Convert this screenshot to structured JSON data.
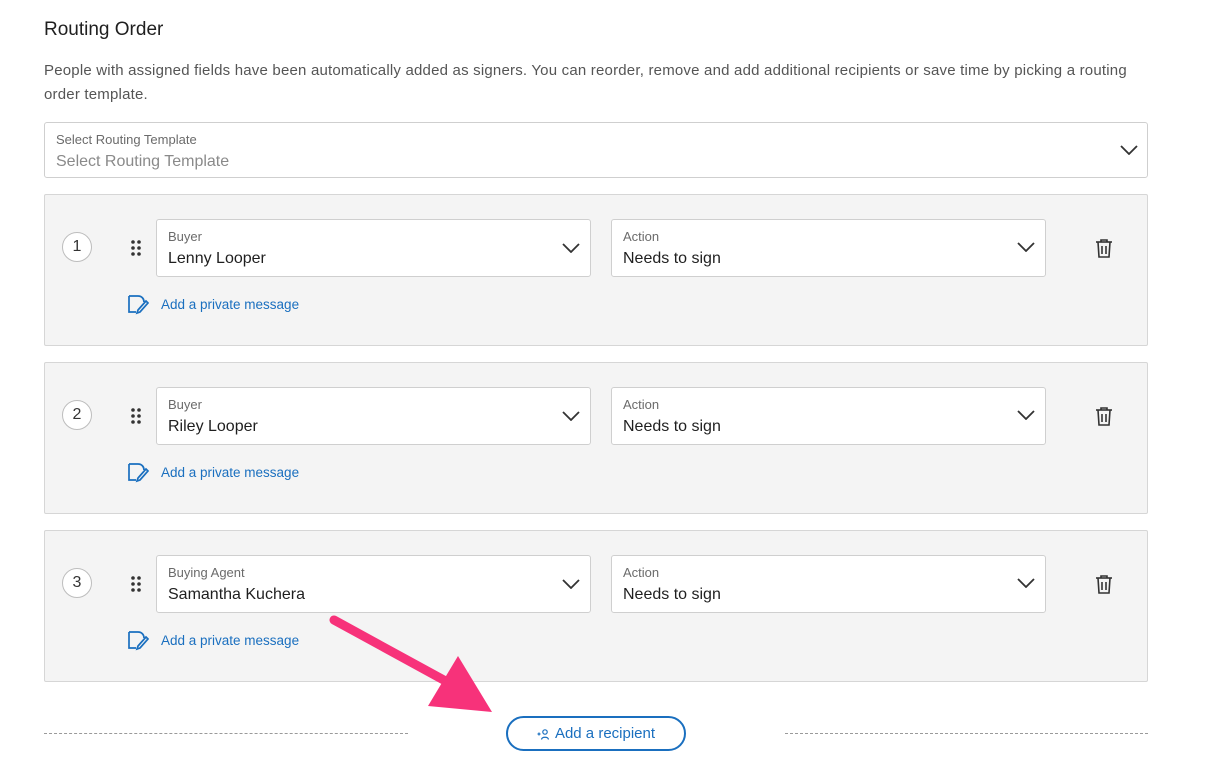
{
  "section": {
    "title": "Routing Order",
    "description": "People with assigned fields have been automatically added as signers. You can reorder, remove and add additional recipients or save time by picking a routing order template."
  },
  "template_select": {
    "label": "Select Routing Template",
    "placeholder": "Select Routing Template"
  },
  "recipients": [
    {
      "number": "1",
      "role": "Buyer",
      "name": "Lenny Looper",
      "action_label": "Action",
      "action": "Needs to sign",
      "message_link": "Add a private message"
    },
    {
      "number": "2",
      "role": "Buyer",
      "name": "Riley Looper",
      "action_label": "Action",
      "action": "Needs to sign",
      "message_link": "Add a private message"
    },
    {
      "number": "3",
      "role": "Buying Agent",
      "name": "Samantha Kuchera",
      "action_label": "Action",
      "action": "Needs to sign",
      "message_link": "Add a private message"
    }
  ],
  "add_recipient": {
    "label": "Add a recipient"
  },
  "colors": {
    "link": "#1a6fbf",
    "annotation_arrow": "#f7327a",
    "row_bg": "#f4f4f4"
  },
  "icons": [
    "chevron-down-icon",
    "drag-handle-icon",
    "trash-icon",
    "edit-message-icon",
    "add-person-icon",
    "annotation-arrow"
  ]
}
